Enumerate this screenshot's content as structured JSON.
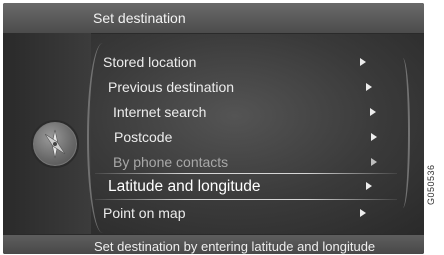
{
  "header": {
    "title": "Set destination"
  },
  "menu": {
    "items": [
      {
        "label": "Stored location",
        "state": "normal"
      },
      {
        "label": "Previous destination",
        "state": "normal"
      },
      {
        "label": "Internet search",
        "state": "normal"
      },
      {
        "label": "Postcode",
        "state": "normal"
      },
      {
        "label": "By phone contacts",
        "state": "disabled"
      },
      {
        "label": "Latitude and longitude",
        "state": "selected"
      },
      {
        "label": "Point on map",
        "state": "normal"
      }
    ]
  },
  "footer": {
    "text": "Set destination by entering latitude and longitude"
  },
  "side_panel": {
    "icon": "compass-icon"
  },
  "watermark": "G050536",
  "colors": {
    "screen_bg": "#3a3a3a",
    "header_bg": "#5a5a5a",
    "text": "#ededed",
    "dim_text": "#a8a8a8"
  }
}
